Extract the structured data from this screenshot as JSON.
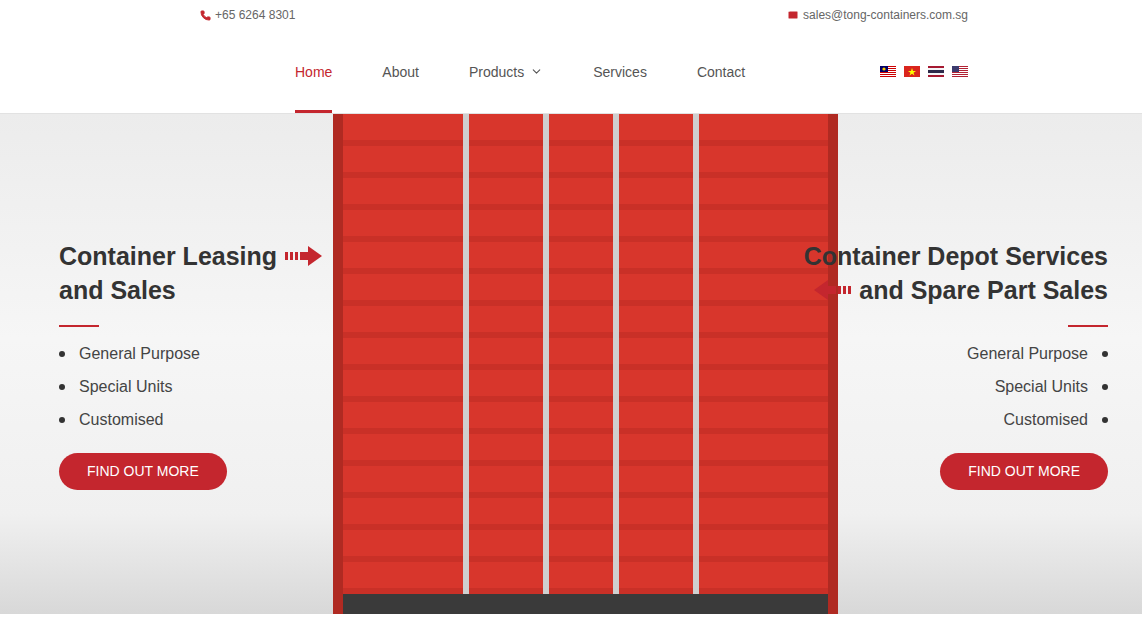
{
  "topbar": {
    "phone": "+65 6264 8301",
    "email": "sales@tong-containers.com.sg"
  },
  "nav": [
    {
      "label": "Home",
      "selected": true,
      "dropdown": false
    },
    {
      "label": "About",
      "selected": false,
      "dropdown": false
    },
    {
      "label": "Products",
      "selected": false,
      "dropdown": true
    },
    {
      "label": "Services",
      "selected": false,
      "dropdown": false
    },
    {
      "label": "Contact",
      "selected": false,
      "dropdown": false
    }
  ],
  "panels": [
    {
      "heading": [
        "Container Leasing",
        "and Sales"
      ],
      "bullets": [
        "General Purpose",
        "Special Units",
        "Customised"
      ],
      "button": "FIND OUT MORE"
    },
    {
      "heading": [
        "Container Depot Services",
        "and Spare Part Sales"
      ],
      "bullets": [
        "General Purpose",
        "Special Units",
        "Customised"
      ],
      "button": "FIND OUT MORE"
    }
  ]
}
